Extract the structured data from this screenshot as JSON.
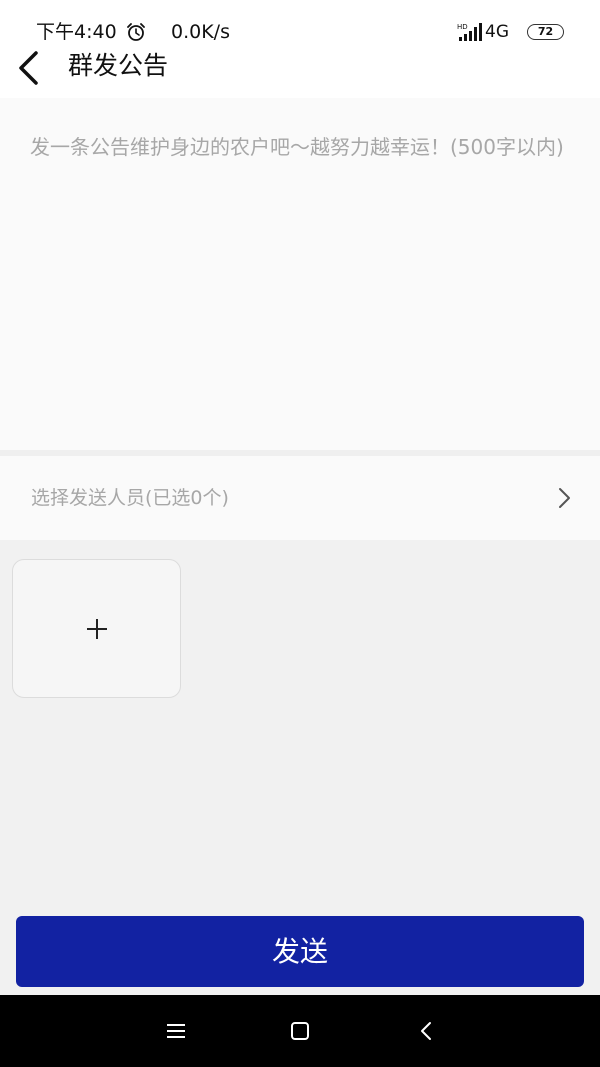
{
  "status_bar": {
    "time": "下午4:40",
    "speed": "0.0K/s",
    "network": "4G",
    "battery": "72"
  },
  "header": {
    "title": "群发公告"
  },
  "notice": {
    "placeholder": "发一条公告维护身边的农户吧～越努力越幸运！(500字以内)",
    "value": ""
  },
  "recipients": {
    "label": "选择发送人员(已选0个)"
  },
  "actions": {
    "send_label": "发送"
  },
  "colors": {
    "primary": "#1222a2",
    "background": "#f1f1f1",
    "placeholder": "#a7a7a7"
  }
}
